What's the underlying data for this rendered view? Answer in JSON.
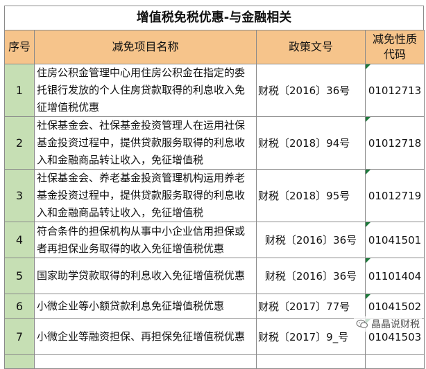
{
  "title": "增值税免税优惠-与金融相关",
  "headers": {
    "no": "序号",
    "name": "减免项目名称",
    "doc": "政策文号",
    "code": "减免性质代码"
  },
  "rows": [
    {
      "no": "1",
      "name": "住房公积金管理中心用住房公积金在指定的委托银行发放的个人住房贷款取得的利息收入免征增值税优惠",
      "doc": "财税〔2016〕36号",
      "code": "01012713"
    },
    {
      "no": "2",
      "name": "社保基金会、社保基金投资管理人在运用社保基金投资过程中，提供贷款服务取得的利息收入和金融商品转让收入，免征增值税",
      "doc": "财税〔2018〕94号",
      "code": "01012718"
    },
    {
      "no": "3",
      "name": "社保基金会、养老基金投资管理机构运用养老基金投资过程中，提供贷款服务取得的利息收入和金融商品转让收入，免征增值税",
      "doc": "财税〔2018〕95号",
      "code": "01012719"
    },
    {
      "no": "4",
      "name": "符合条件的担保机构从事中小企业信用担保或者再担保业务取得的收入免征增值税优惠",
      "doc": "财税〔2016〕36号",
      "code": "01041501"
    },
    {
      "no": "5",
      "name": "国家助学贷款取得的利息收入免征增值税优惠",
      "doc": "财税〔2016〕36号",
      "code": "01101404"
    },
    {
      "no": "6",
      "name": "小微企业等小额贷款利息免征增值税优惠",
      "doc": "财税〔2017〕77号",
      "code": "01041502"
    },
    {
      "no": "7",
      "name": "小微企业等融资担保、再担保免征增值税优惠",
      "doc": "财税〔2017〕9_号",
      "code": "01041503"
    }
  ],
  "watermark": "晶晶说财税"
}
